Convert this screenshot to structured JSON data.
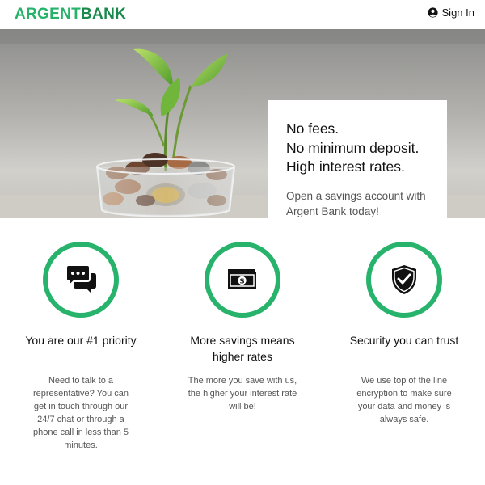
{
  "header": {
    "logo": {
      "part1": "ARGENT",
      "part2": "BANK"
    },
    "signin_label": "Sign In"
  },
  "hero": {
    "headline": [
      "No fees.",
      "No minimum deposit.",
      "High interest rates."
    ],
    "subtext": "Open a savings account with Argent Bank today!",
    "image": "plant-in-jar-of-coins"
  },
  "features": [
    {
      "icon": "chat-icon",
      "title": "You are our #1 priority",
      "text": "Need to talk to a representative? You can get in touch through our 24/7 chat or through a phone call in less than 5 minutes."
    },
    {
      "icon": "money-icon",
      "title": "More savings means higher rates",
      "text": "The more you save with us, the higher your interest rate will be!"
    },
    {
      "icon": "security-shield-icon",
      "title": "Security you can trust",
      "text": "We use top of the line encryption to make sure your data and money is always safe."
    }
  ],
  "colors": {
    "brand_green": "#27b36b",
    "brand_dark_green": "#1a8a4c"
  }
}
